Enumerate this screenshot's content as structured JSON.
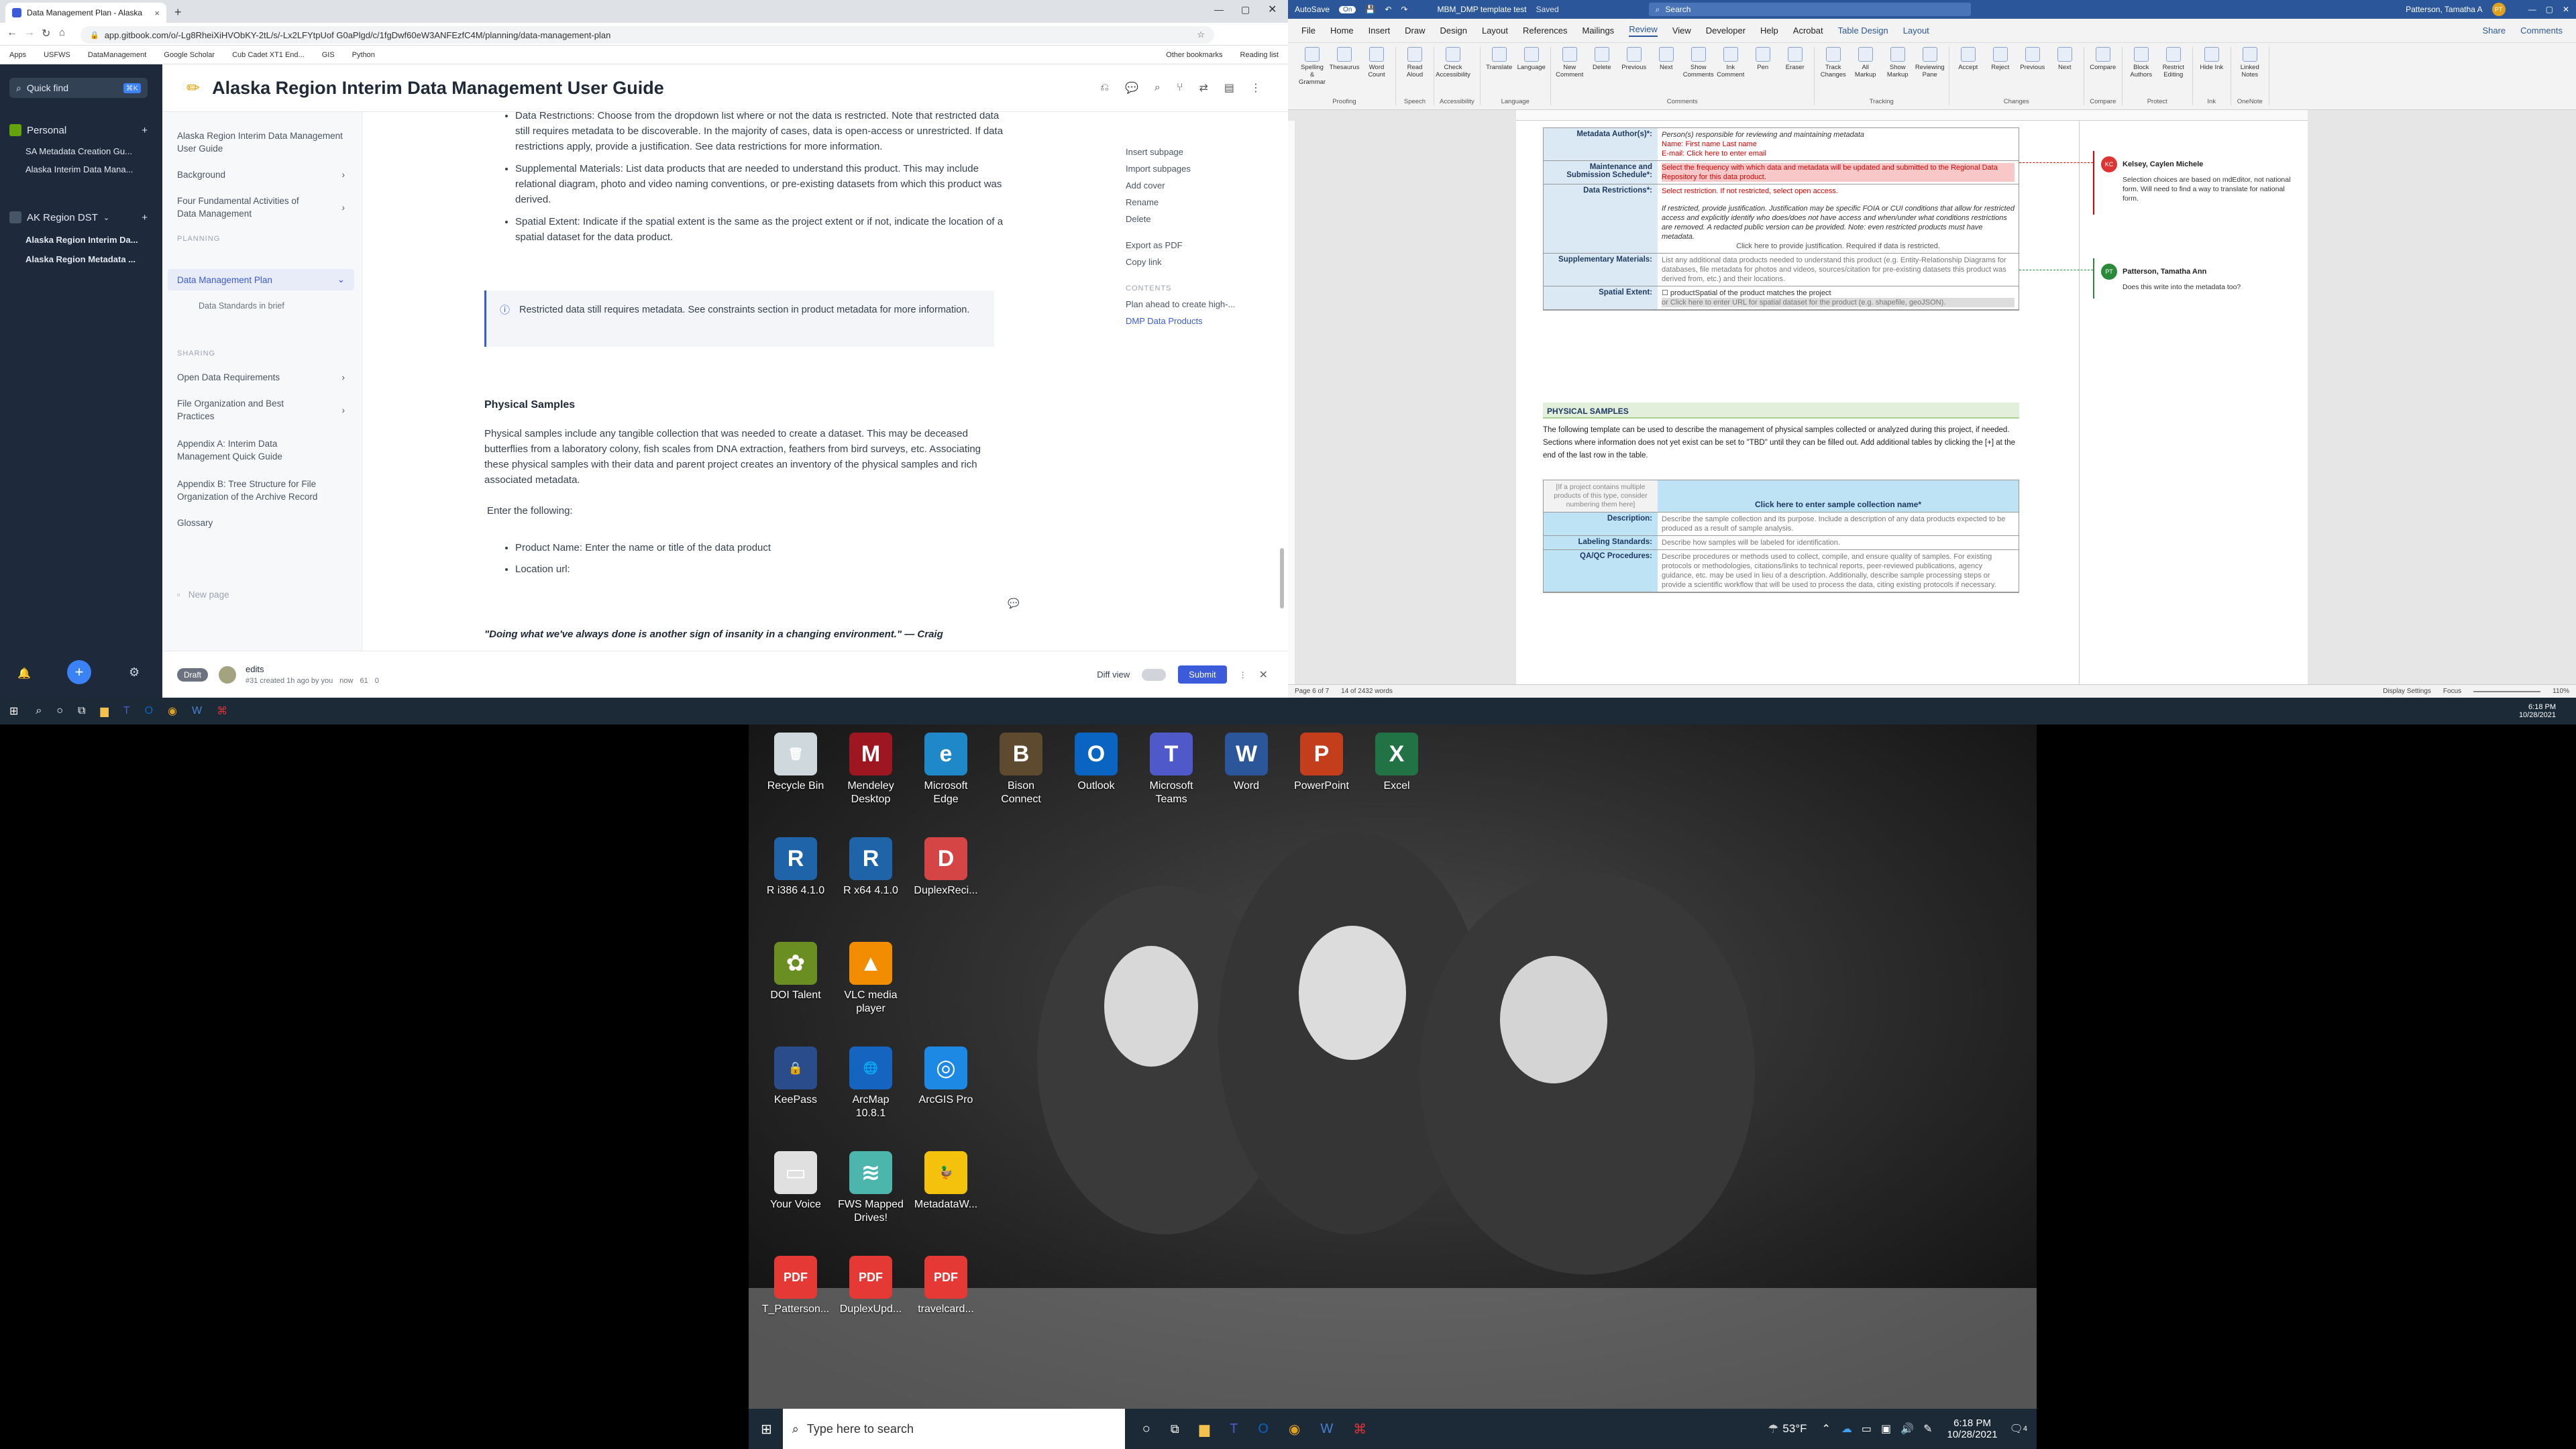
{
  "browser": {
    "tab_title": "Data Management Plan - Alaska",
    "url": "app.gitbook.com/o/-Lg8RheiXiHVObKY-2tL/s/-Lx2LFYtpUof G0aPlgd/c/1fgDwf60eW3ANFEzfC4M/planning/data-management-plan",
    "bookmarks": [
      "Apps",
      "USFWS",
      "DataManagement",
      "Google Scholar",
      "Cub Cadet XT1 End...",
      "GIS",
      "Python",
      "Other bookmarks",
      "Reading list"
    ]
  },
  "gitbook": {
    "quick_find": "Quick find",
    "quick_find_key": "⌘K",
    "personal_label": "Personal",
    "personal_items": [
      "SA Metadata Creation Gu...",
      "Alaska Interim Data Mana..."
    ],
    "org_label": "AK Region DST",
    "org_items": [
      "Alaska Region Interim Da...",
      "Alaska Region Metadata ..."
    ],
    "page_title": "Alaska Region Interim Data Management User Guide",
    "nav": [
      {
        "label": "Alaska Region Interim Data Management User Guide",
        "chev": false
      },
      {
        "label": "Background",
        "chev": true
      },
      {
        "label": "Four Fundamental Activities of Data Management",
        "chev": true
      }
    ],
    "nav_section_planning": "PLANNING",
    "nav_active": "Data Management Plan",
    "nav_sub": "Data Standards in brief",
    "nav_section_sharing": "SHARING",
    "nav2": [
      {
        "label": "Open Data Requirements",
        "chev": true
      },
      {
        "label": "File Organization and Best Practices",
        "chev": true
      },
      {
        "label": "Appendix A: Interim Data Management Quick Guide",
        "chev": false
      },
      {
        "label": "Appendix B: Tree Structure for File Organization of the Archive Record",
        "chev": false
      },
      {
        "label": "Glossary",
        "chev": false
      }
    ],
    "new_page": "New page",
    "bullets": [
      "Data Restrictions:  Choose from the dropdown list where or not the data is restricted.  Note that restricted data still requires metadata to be discoverable.  In the majority of cases, data is open-access or unrestricted.  If data restrictions apply, provide a justification.  See data restrictions for more information.",
      "Supplemental Materials:  List data products that are needed to understand this product.  This may include relational diagram, photo and video naming conventions, or pre-existing datasets from which this product was derived.",
      "Spatial Extent:  Indicate if the spatial extent is the same as the project extent or if not, indicate the location of a spatial dataset for the data product."
    ],
    "hint": "Restricted data still requires metadata.  See constraints section in product metadata for more information.",
    "section_heading": "Physical Samples",
    "section_text": "Physical samples include any tangible collection that was needed to create a dataset.  This may be deceased butterflies from a laboratory colony, fish scales from DNA extraction, feathers from bird surveys, etc.  Associating these physical samples with their data and parent project creates an inventory of the physical samples and rich associated metadata.",
    "enter_following": "Enter the following:",
    "bullets2": [
      "Product Name:  Enter the name or title of the data product",
      "Location url:"
    ],
    "quote": "\"Doing what we've always done is another sign of insanity in a changing environment.\" — Craig",
    "actions": [
      "Insert subpage",
      "Import subpages",
      "Add cover",
      "Rename",
      "Delete",
      "Export as PDF",
      "Copy link"
    ],
    "contents_label": "CONTENTS",
    "contents_items": [
      "Plan ahead to create high-...",
      "DMP Data Products"
    ],
    "footer": {
      "draft": "Draft",
      "edits": "edits",
      "created": "#31 created 1h ago by you",
      "now": "now",
      "count1": "61",
      "count2": "0",
      "diff_view": "Diff view",
      "submit": "Submit"
    }
  },
  "word": {
    "autosave": "AutoSave",
    "autosave_state": "On",
    "doc_title": "MBM_DMP template test",
    "saved": "Saved",
    "search": "Search",
    "user": "Patterson, Tamatha A",
    "user_initials": "PT",
    "menu": [
      "File",
      "Home",
      "Insert",
      "Draw",
      "Design",
      "Layout",
      "References",
      "Mailings",
      "Review",
      "View",
      "Developer",
      "Help",
      "Acrobat",
      "Table Design",
      "Layout"
    ],
    "share": "Share",
    "comments_btn": "Comments",
    "ribbon_groups": [
      {
        "name": "Proofing",
        "items": [
          "Spelling & Grammar",
          "Thesaurus",
          "Word Count"
        ]
      },
      {
        "name": "Speech",
        "items": [
          "Read Aloud"
        ]
      },
      {
        "name": "Accessibility",
        "items": [
          "Check Accessibility"
        ]
      },
      {
        "name": "Language",
        "items": [
          "Translate",
          "Language"
        ]
      },
      {
        "name": "Comments",
        "items": [
          "New Comment",
          "Delete",
          "Previous",
          "Next",
          "Show Comments",
          "Ink Comment",
          "Pen",
          "Eraser"
        ]
      },
      {
        "name": "Tracking",
        "items": [
          "Track Changes",
          "All Markup",
          "Show Markup",
          "Reviewing Pane"
        ]
      },
      {
        "name": "Changes",
        "items": [
          "Accept",
          "Reject",
          "Previous",
          "Next"
        ]
      },
      {
        "name": "Compare",
        "items": [
          "Compare"
        ]
      },
      {
        "name": "Protect",
        "items": [
          "Block Authors",
          "Restrict Editing"
        ]
      },
      {
        "name": "Ink",
        "items": [
          "Hide Ink"
        ]
      },
      {
        "name": "OneNote",
        "items": [
          "Linked Notes"
        ]
      }
    ],
    "table1": [
      {
        "label": "Metadata Author(s)*:",
        "lines": [
          {
            "t": "Person(s) responsible for reviewing and maintaining metadata",
            "c": "#333",
            "i": true
          },
          {
            "t": "Name: First name Last name",
            "c": "#d00"
          },
          {
            "t": "E-mail: Click here to enter email",
            "c": "#d00"
          }
        ]
      },
      {
        "label": "Maintenance and Submission Schedule*:",
        "lines": [
          {
            "t": "Select the frequency with which data and metadata will be updated and submitted to the Regional Data Repository for this data product.",
            "c": "#d00",
            "hl": true
          }
        ]
      },
      {
        "label": "Data Restrictions*:",
        "lines": [
          {
            "t": "Select restriction. If not restricted, select open access.",
            "c": "#d00"
          },
          {
            "t": "",
            "c": "#333"
          },
          {
            "t": "If restricted, provide justification. Justification may be specific FOIA or CUI conditions that allow for restricted access and explicitly identify who does/does not have access and when/under what conditions restrictions are removed. A redacted public version can be provided. Note: even restricted products must have metadata.",
            "c": "#333",
            "i": true
          },
          {
            "t": "Click here to provide justification. Required if data is restricted.",
            "c": "#555",
            "center": true
          }
        ]
      },
      {
        "label": "Supplementary Materials:",
        "lines": [
          {
            "t": "List any additional data products needed to understand this product (e.g. Entity-Relationship Diagrams for databases, file metadata for photos and videos, sources/citation for pre-existing datasets this product was derived from, etc.) and their locations.",
            "c": "#777"
          }
        ]
      },
      {
        "label": "Spatial Extent:",
        "lines": [
          {
            "t": "☐ productSpatial of the product matches the project",
            "c": "#333"
          },
          {
            "t": "or Click here to enter URL for spatial dataset for the product (e.g. shapefile, geoJSON).",
            "c": "#777",
            "hl2": true
          }
        ]
      }
    ],
    "section_title": "PHYSICAL SAMPLES",
    "section_text": "The following template can be used to describe the management of physical samples collected or analyzed during this project, if needed. Sections where information does not yet exist can be set to \"TBD\" until they can be filled out. Add additional tables by clicking the [+] at the end of the last row in the table.",
    "table2_note": "[If a project contains multiple products of this type, consider numbering them here]",
    "table2_head": "Click here to enter sample collection name*",
    "table2": [
      {
        "label": "Description:",
        "text": "Describe the sample collection and its purpose. Include a description of any data products expected to be produced as a result of sample analysis."
      },
      {
        "label": "Labeling Standards:",
        "text": "Describe how samples will be labeled for identification."
      },
      {
        "label": "QA/QC Procedures:",
        "text": "Describe procedures or methods used to collect, compile, and ensure quality of samples. For existing protocols or methodologies, citations/links to technical reports, peer-reviewed publications, agency guidance, etc. may be used in lieu of a description. Additionally, describe sample processing steps or provide a scientific workflow that will be used to process the data, citing existing protocols if necessary."
      }
    ],
    "comment1": {
      "initials": "KC",
      "author": "Kelsey, Caylen Michele",
      "text": "Selection choices are based on mdEditor, not national form. Will need to find a way to translate for national form."
    },
    "comment2": {
      "initials": "PT",
      "author": "Patterson, Tamatha Ann",
      "text": "Does this write into the metadata too?"
    },
    "status_page": "Page 6 of 7",
    "status_words": "14 of 2432 words",
    "status_display": "Display Settings",
    "status_focus": "Focus",
    "status_zoom": "110%"
  },
  "taskbar_top": {
    "time": "6:18 PM",
    "date": "10/28/2021"
  },
  "desktop": {
    "icons": [
      {
        "label": "Recycle Bin",
        "color": "#cfd8dc",
        "glyph": "🗑"
      },
      {
        "label": "Mendeley Desktop",
        "color": "#9d1620",
        "glyph": "M"
      },
      {
        "label": "Microsoft Edge",
        "color": "#1e88c8",
        "glyph": "e"
      },
      {
        "label": "Bison Connect",
        "color": "#5d4a2f",
        "glyph": "B"
      },
      {
        "label": "Outlook",
        "color": "#0a64c2",
        "glyph": "O"
      },
      {
        "label": "Microsoft Teams",
        "color": "#5059c9",
        "glyph": "T"
      },
      {
        "label": "Word",
        "color": "#2b579a",
        "glyph": "W"
      },
      {
        "label": "PowerPoint",
        "color": "#c43e1c",
        "glyph": "P"
      },
      {
        "label": "Excel",
        "color": "#217346",
        "glyph": "X"
      },
      {
        "label": "R i386 4.1.0",
        "color": "#1f63a8",
        "glyph": "R"
      },
      {
        "label": "R x64 4.1.0",
        "color": "#1f63a8",
        "glyph": "R"
      },
      {
        "label": "DuplexReci...",
        "color": "#d64545",
        "glyph": "D"
      },
      {
        "label": "DOI Talent",
        "color": "#6b8e23",
        "glyph": "✿"
      },
      {
        "label": "VLC media player",
        "color": "#f28c00",
        "glyph": "▲"
      },
      {
        "label": "KeePass",
        "color": "#2b4c8a",
        "glyph": "🔒"
      },
      {
        "label": "ArcMap 10.8.1",
        "color": "#1565c0",
        "glyph": "🌐"
      },
      {
        "label": "ArcGIS Pro",
        "color": "#1e88e5",
        "glyph": "◎"
      },
      {
        "label": "Your Voice",
        "color": "#e0e0e0",
        "glyph": "▭"
      },
      {
        "label": "FWS Mapped Drives!",
        "color": "#4db6ac",
        "glyph": "≋"
      },
      {
        "label": "MetadataW...",
        "color": "#f4c20d",
        "glyph": "🦆"
      },
      {
        "label": "T_Patterson...",
        "color": "#e53935",
        "glyph": "PDF"
      },
      {
        "label": "DuplexUpd...",
        "color": "#e53935",
        "glyph": "PDF"
      },
      {
        "label": "travelcard...",
        "color": "#e53935",
        "glyph": "PDF"
      }
    ],
    "search_placeholder": "Type here to search",
    "weather": "53°F",
    "time": "6:18 PM",
    "date": "10/28/2021",
    "notif": "4"
  },
  "colors": {
    "accent": "#3b5bdb",
    "word_blue": "#2b579a",
    "gitbook_rail": "#1e293b"
  }
}
